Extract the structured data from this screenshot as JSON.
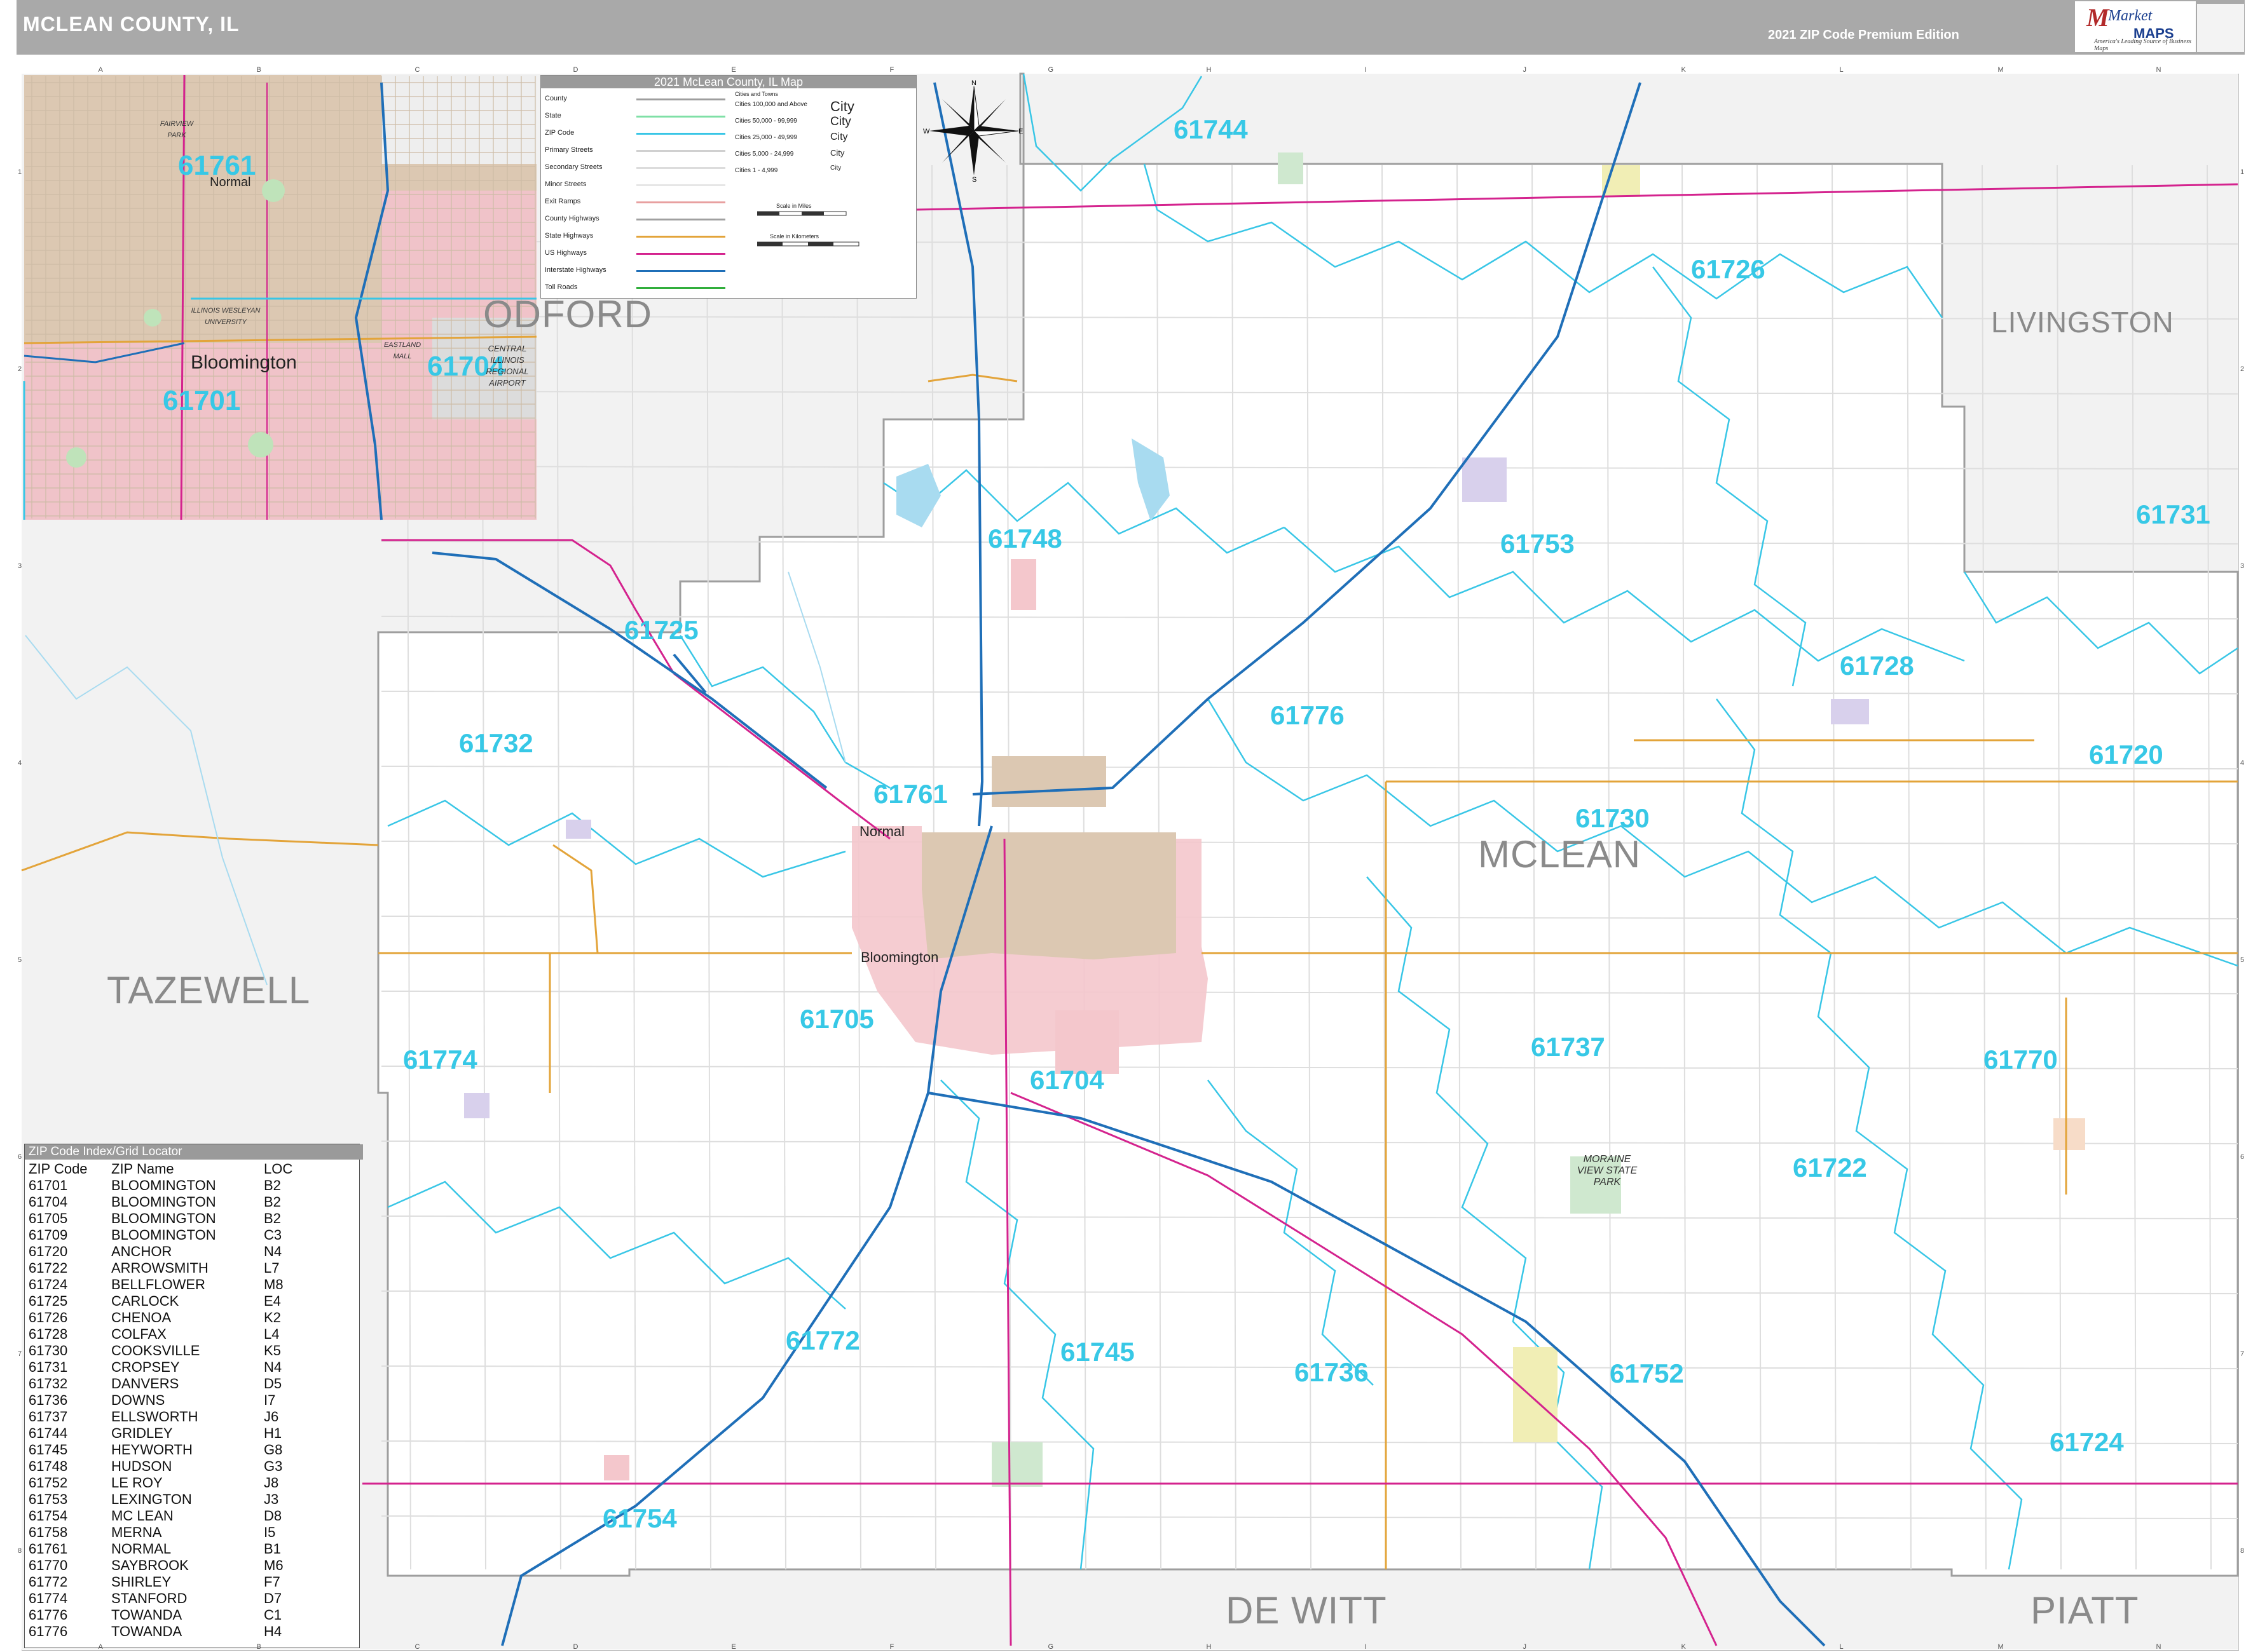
{
  "header": {
    "title": "MCLEAN COUNTY, IL",
    "edition": "2021 ZIP Code Premium Edition"
  },
  "logo": {
    "brand_line1": "Market",
    "brand_line2": "MAPS",
    "tagline": "America's Leading Source of Business Maps"
  },
  "legend": {
    "title": "2021 McLean County, IL Map",
    "line_items": [
      {
        "label": "County",
        "color": "#9e9e9e"
      },
      {
        "label": "State",
        "color": "#7fe0a6"
      },
      {
        "label": "ZIP Code",
        "color": "#38c6e6"
      },
      {
        "label": "Primary Streets",
        "color": "#d0d0d0"
      },
      {
        "label": "Secondary Streets",
        "color": "#dcdcdc"
      },
      {
        "label": "Minor Streets",
        "color": "#e6e6e6"
      },
      {
        "label": "Exit Ramps",
        "color": "#e8a0a0"
      },
      {
        "label": "County Highways",
        "color": "#a0a0a0"
      },
      {
        "label": "State Highways",
        "color": "#e3a43a"
      },
      {
        "label": "US Highways",
        "color": "#d4238e"
      },
      {
        "label": "Interstate Highways",
        "color": "#1f6fb8"
      },
      {
        "label": "Toll Roads",
        "color": "#2fae3a"
      }
    ],
    "cities_heading": "Cities and Towns",
    "city_classes": [
      {
        "label": "Cities 100,000 and Above",
        "sample": "City"
      },
      {
        "label": "Cities 50,000 - 99,999",
        "sample": "City"
      },
      {
        "label": "Cities 25,000 - 49,999",
        "sample": "City"
      },
      {
        "label": "Cities 5,000 - 24,999",
        "sample": "City"
      },
      {
        "label": "Cities 1 - 4,999",
        "sample": "City"
      }
    ],
    "scale_miles": "Scale in Miles",
    "scale_km": "Scale in Kilometers"
  },
  "compass": {
    "n": "N",
    "s": "S",
    "e": "E",
    "w": "W"
  },
  "counties": [
    "WOODFORD",
    "LIVINGSTON",
    "TAZEWELL",
    "MCLEAN",
    "DE WITT",
    "PIATT"
  ],
  "zip_labels": [
    "61744",
    "61726",
    "61731",
    "61748",
    "61753",
    "61725",
    "61728",
    "61732",
    "61776",
    "61720",
    "61761",
    "61730",
    "61705",
    "61737",
    "61770",
    "61774",
    "61704",
    "61722",
    "61772",
    "61745",
    "61736",
    "61752",
    "61724",
    "61754"
  ],
  "cities": [
    "Bloomington",
    "Normal"
  ],
  "park_label": "MORAINE VIEW STATE PARK",
  "inset": {
    "zip_labels": [
      "61761",
      "61704",
      "61701"
    ],
    "cities": [
      "Bloomington",
      "Normal"
    ],
    "county_partial": "ODFORD",
    "places": [
      "CENTRAL ILLINOIS REGIONAL AIRPORT",
      "ILLINOIS WESLEYAN UNIVERSITY",
      "EASTLAND MALL",
      "FAIRVIEW PARK"
    ]
  },
  "zip_index": {
    "title": "ZIP Code Index/Grid Locator",
    "columns": [
      "ZIP Code",
      "ZIP Name",
      "LOC"
    ],
    "rows": [
      [
        "61701",
        "BLOOMINGTON",
        "B2"
      ],
      [
        "61704",
        "BLOOMINGTON",
        "B2"
      ],
      [
        "61705",
        "BLOOMINGTON",
        "B2"
      ],
      [
        "61709",
        "BLOOMINGTON",
        "C3"
      ],
      [
        "61720",
        "ANCHOR",
        "N4"
      ],
      [
        "61722",
        "ARROWSMITH",
        "L7"
      ],
      [
        "61724",
        "BELLFLOWER",
        "M8"
      ],
      [
        "61725",
        "CARLOCK",
        "E4"
      ],
      [
        "61726",
        "CHENOA",
        "K2"
      ],
      [
        "61728",
        "COLFAX",
        "L4"
      ],
      [
        "61730",
        "COOKSVILLE",
        "K5"
      ],
      [
        "61731",
        "CROPSEY",
        "N4"
      ],
      [
        "61732",
        "DANVERS",
        "D5"
      ],
      [
        "61736",
        "DOWNS",
        "I7"
      ],
      [
        "61737",
        "ELLSWORTH",
        "J6"
      ],
      [
        "61744",
        "GRIDLEY",
        "H1"
      ],
      [
        "61745",
        "HEYWORTH",
        "G8"
      ],
      [
        "61748",
        "HUDSON",
        "G3"
      ],
      [
        "61752",
        "LE ROY",
        "J8"
      ],
      [
        "61753",
        "LEXINGTON",
        "J3"
      ],
      [
        "61754",
        "MC LEAN",
        "D8"
      ],
      [
        "61758",
        "MERNA",
        "I5"
      ],
      [
        "61761",
        "NORMAL",
        "B1"
      ],
      [
        "61770",
        "SAYBROOK",
        "M6"
      ],
      [
        "61772",
        "SHIRLEY",
        "F7"
      ],
      [
        "61774",
        "STANFORD",
        "D7"
      ],
      [
        "61776",
        "TOWANDA",
        "C1"
      ],
      [
        "61776",
        "TOWANDA",
        "H4"
      ]
    ]
  },
  "grid_columns": [
    "A",
    "B",
    "C",
    "D",
    "E",
    "F",
    "G",
    "H",
    "I",
    "J",
    "K",
    "L",
    "M",
    "N"
  ],
  "grid_rows": [
    "1",
    "2",
    "3",
    "4",
    "5",
    "6",
    "7",
    "8"
  ]
}
